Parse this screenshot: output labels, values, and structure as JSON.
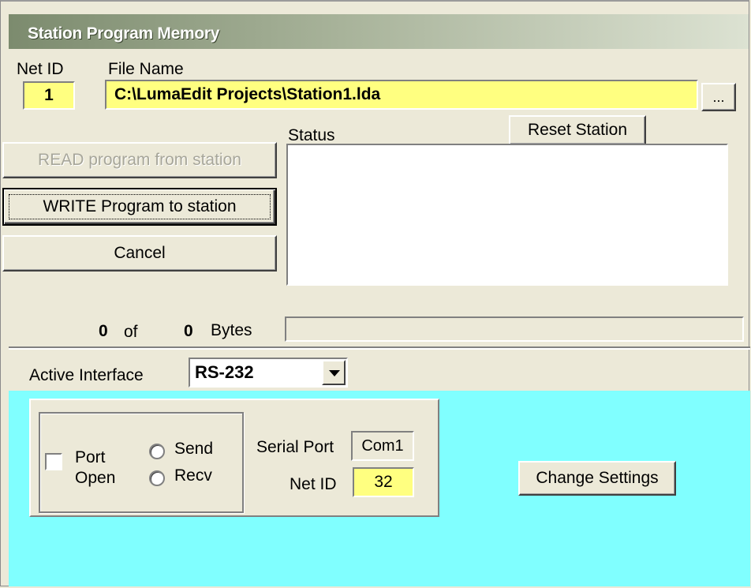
{
  "window": {
    "title": "Station Program Memory"
  },
  "header": {
    "net_id_label": "Net ID",
    "net_id_value": "1",
    "file_name_label": "File Name",
    "file_name_value": "C:\\LumaEdit Projects\\Station1.lda",
    "browse_label": "..."
  },
  "actions": {
    "read_label": "READ program from station",
    "write_label": "WRITE Program to station",
    "cancel_label": "Cancel",
    "reset_label": "Reset Station"
  },
  "status": {
    "label": "Status",
    "text": ""
  },
  "progress": {
    "current": "0",
    "of_label": "of",
    "total": "0",
    "bytes_label": "Bytes",
    "fraction": 0
  },
  "interface": {
    "label": "Active Interface",
    "selected": "RS-232",
    "port_label_line1": "Port",
    "port_label_line2": "Open",
    "port_open_checked": false,
    "send_label": "Send",
    "recv_label": "Recv",
    "serial_port_label": "Serial Port",
    "serial_port_value": "Com1",
    "net_id_label": "Net ID",
    "net_id_value": "32",
    "change_settings_label": "Change Settings"
  },
  "colors": {
    "highlight_field": "#ffff80",
    "interface_panel": "#80ffff",
    "dialog_face": "#ece9d8"
  }
}
